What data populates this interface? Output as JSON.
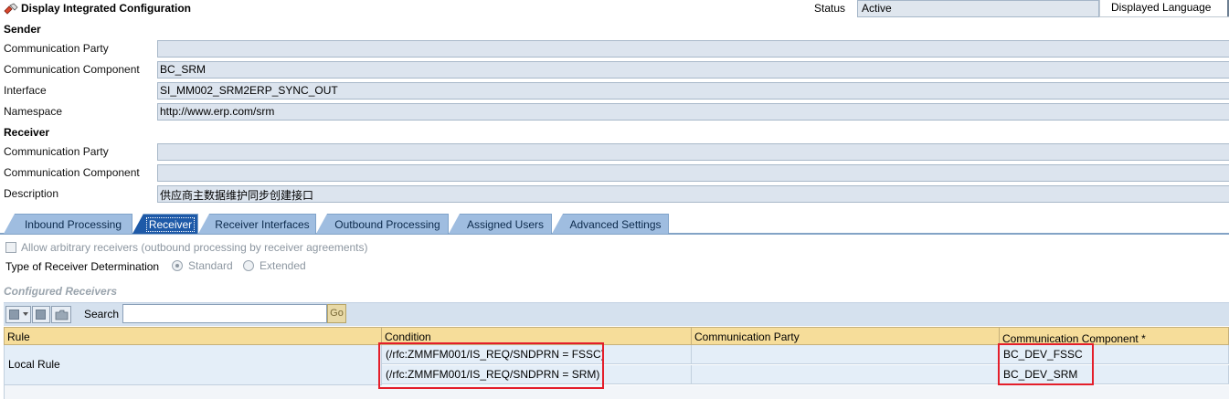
{
  "header": {
    "title": "Display Integrated Configuration",
    "status_label": "Status",
    "status_value": "Active",
    "language_label": "Displayed Language"
  },
  "sender": {
    "section_title": "Sender",
    "rows": [
      {
        "label": "Communication Party",
        "value": ""
      },
      {
        "label": "Communication Component",
        "value": "BC_SRM"
      },
      {
        "label": "Interface",
        "value": "SI_MM002_SRM2ERP_SYNC_OUT"
      },
      {
        "label": "Namespace",
        "value": "http://www.erp.com/srm"
      }
    ]
  },
  "receiver": {
    "section_title": "Receiver",
    "rows": [
      {
        "label": "Communication Party",
        "value": ""
      },
      {
        "label": "Communication Component",
        "value": ""
      },
      {
        "label": "Description",
        "value": "供应商主数据维护同步创建接口"
      }
    ]
  },
  "tabs": [
    {
      "label": "Inbound Processing",
      "active": false
    },
    {
      "label": "Receiver",
      "active": true
    },
    {
      "label": "Receiver Interfaces",
      "active": false
    },
    {
      "label": "Outbound Processing",
      "active": false
    },
    {
      "label": "Assigned Users",
      "active": false
    },
    {
      "label": "Advanced Settings",
      "active": false
    }
  ],
  "receiver_tab": {
    "allow_arbitrary_label": "Allow arbitrary receivers (outbound processing by receiver agreements)",
    "allow_arbitrary_checked": false,
    "determination_label": "Type of Receiver Determination",
    "option_standard": "Standard",
    "option_extended": "Extended",
    "selected": "Standard",
    "configured_title": "Configured Receivers",
    "search_label": "Search",
    "search_value": "",
    "go_label": "Go"
  },
  "table": {
    "columns": [
      "Rule",
      "Condition",
      "Communication Party",
      "Communication Component *"
    ],
    "rule_label": "Local Rule",
    "rows": [
      {
        "condition": "(/rfc:ZMMFM001/IS_REQ/SNDPRN = FSSC)",
        "party": "",
        "component": "BC_DEV_FSSC"
      },
      {
        "condition": "(/rfc:ZMMFM001/IS_REQ/SNDPRN = SRM)",
        "party": "",
        "component": "BC_DEV_SRM"
      }
    ]
  },
  "colors": {
    "tab_active": "#1e5aa8",
    "tab_inactive": "#9fbde0",
    "header_cell": "#f6dd9a",
    "highlight_box": "#e41e2a"
  }
}
